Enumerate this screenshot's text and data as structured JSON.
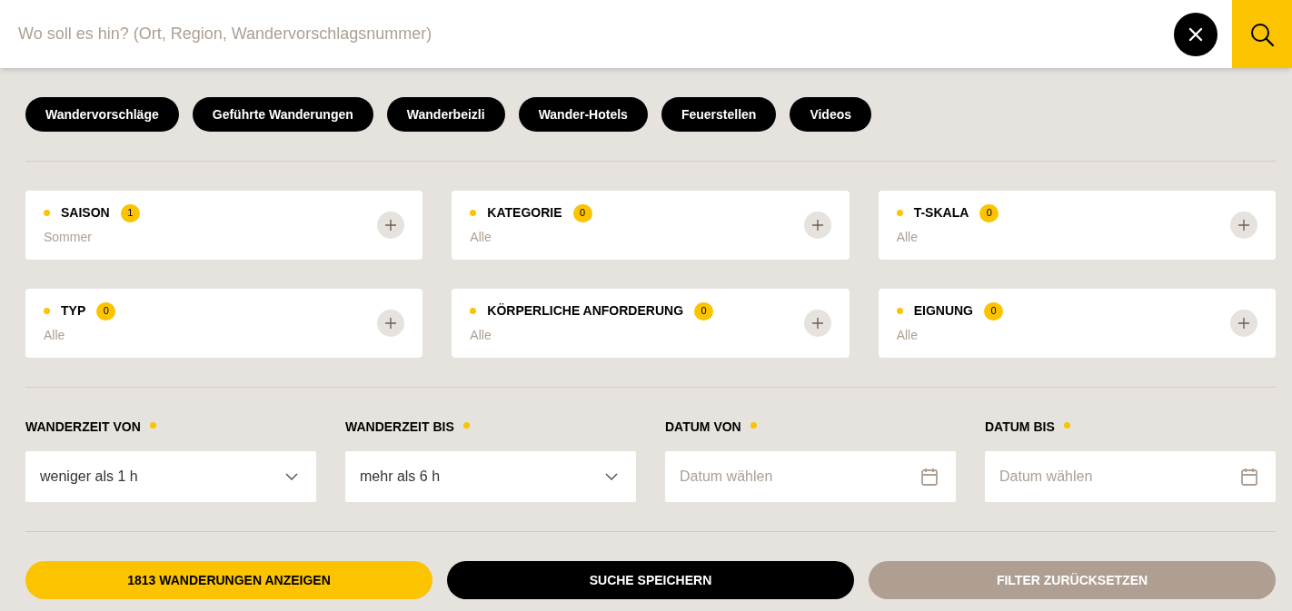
{
  "search": {
    "placeholder": "Wo soll es hin? (Ort, Region, Wandervorschlagsnummer)"
  },
  "categories": [
    "Wandervorschläge",
    "Geführte Wanderungen",
    "Wanderbeizli",
    "Wander-Hotels",
    "Feuerstellen",
    "Videos"
  ],
  "filters": [
    {
      "title": "SAISON",
      "count": "1",
      "value": "Sommer"
    },
    {
      "title": "KATEGORIE",
      "count": "0",
      "value": "Alle"
    },
    {
      "title": "T-SKALA",
      "count": "0",
      "value": "Alle"
    },
    {
      "title": "TYP",
      "count": "0",
      "value": "Alle"
    },
    {
      "title": "KÖRPERLICHE ANFORDERUNG",
      "count": "0",
      "value": "Alle"
    },
    {
      "title": "EIGNUNG",
      "count": "0",
      "value": "Alle"
    }
  ],
  "fields": [
    {
      "kind": "select",
      "label": "WANDERZEIT VON",
      "value": "weniger als 1 h"
    },
    {
      "kind": "select",
      "label": "WANDERZEIT BIS",
      "value": "mehr als 6 h"
    },
    {
      "kind": "date",
      "label": "DATUM VON",
      "placeholder": "Datum wählen"
    },
    {
      "kind": "date",
      "label": "DATUM BIS",
      "placeholder": "Datum wählen"
    }
  ],
  "actions": [
    {
      "kind": "primary",
      "label": "1813 WANDERUNGEN ANZEIGEN"
    },
    {
      "kind": "dark",
      "label": "SUCHE SPEICHERN"
    },
    {
      "kind": "muted",
      "label": "FILTER ZURÜCKSETZEN"
    }
  ]
}
